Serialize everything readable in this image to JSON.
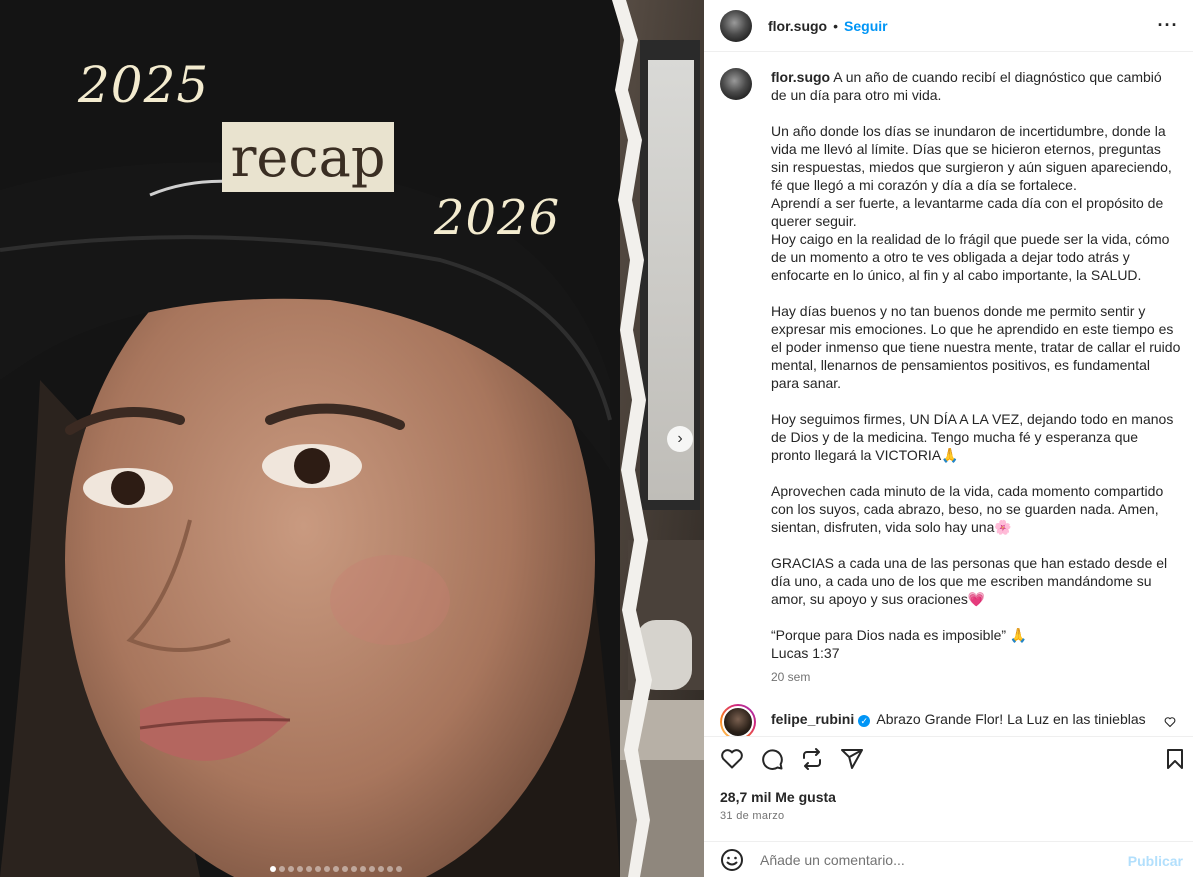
{
  "post": {
    "username": "flor.sugo",
    "separator": "•",
    "follow_label": "Seguir",
    "more_label": "···"
  },
  "media": {
    "overlay_year_start": "2025",
    "overlay_recap": "recap",
    "overlay_year_end": "2026",
    "next_arrow": "›",
    "carousel_count": 15,
    "carousel_active": 1
  },
  "caption": {
    "username": "flor.sugo",
    "paragraphs": [
      "A un año de cuando recibí el diagnóstico que cambió de un día para otro mi vida.",
      "",
      "Un año donde los días se inundaron de incertidumbre, donde la vida me llevó al límite. Días que se hicieron eternos, preguntas sin respuestas, miedos que surgieron y aún siguen apareciendo, fé que llegó a mi corazón y día a día se fortalece.",
      "Aprendí a ser fuerte, a levantarme cada día con el propósito de querer seguir.",
      "Hoy caigo en la realidad de lo frágil que puede ser la vida, cómo de un momento a otro te ves obligada a dejar todo atrás y enfocarte en lo único, al fin y al cabo importante, la SALUD.",
      "",
      "Hay días buenos y no tan buenos donde me permito sentir y expresar mis emociones. Lo que he aprendido en este tiempo es el poder inmenso que tiene nuestra mente, tratar de callar el ruido mental, llenarnos de pensamientos positivos, es fundamental para sanar.",
      "",
      "Hoy seguimos firmes, UN DÍA A LA VEZ, dejando todo en manos de Dios y de la medicina. Tengo mucha fé y esperanza que pronto llegará la VICTORIA🙏",
      "",
      "Aprovechen cada minuto de la vida, cada momento compartido con los suyos, cada abrazo, beso, no se guarden nada. Amen, sientan, disfruten, vida solo hay una🌸",
      "",
      "GRACIAS a cada una de las personas que han estado desde el día uno, a cada uno de los que me escriben mandándome su amor, su apoyo y sus oraciones💗",
      "",
      "“Porque para Dios nada es imposible” 🙏",
      "Lucas 1:37"
    ],
    "time_ago": "20 sem"
  },
  "comment": {
    "username": "felipe_rubini",
    "verified_mark": "✓",
    "text": "Abrazo Grande Flor! La Luz en las tinieblas"
  },
  "actions": {
    "likes": "28,7 mil Me gusta",
    "date": "31 de marzo"
  },
  "add_comment": {
    "placeholder": "Añade un comentario...",
    "post_label": "Publicar"
  },
  "colors": {
    "accent": "#0095f6",
    "post_disabled": "#b2dffc",
    "secondary_text": "#737373",
    "overlay_text": "#f3ebcf"
  }
}
